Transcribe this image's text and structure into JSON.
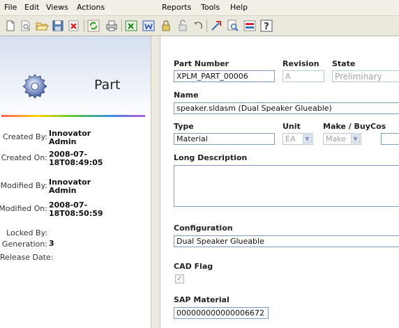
{
  "menubar": {
    "items": [
      "File",
      "Edit",
      "Views",
      "Actions",
      "Reports",
      "Tools",
      "Help"
    ]
  },
  "toolbar": {
    "icons": [
      "new-document-icon",
      "print-preview-icon",
      "open-folder-icon",
      "save-icon",
      "delete-icon",
      "refresh-icon",
      "print-icon",
      "excel-icon",
      "word-icon",
      "lock-icon",
      "unlock-icon",
      "undo-icon",
      "promote-icon",
      "search-icon",
      "report-icon",
      "help-icon"
    ]
  },
  "header": {
    "title": "Part"
  },
  "meta": {
    "created_by_label": "Created By:",
    "created_by": "Innovator Admin",
    "created_on_label": "Created On:",
    "created_on": "2008-07-18T08:49:05",
    "modified_by_label": "Modified By:",
    "modified_by": "Innovator Admin",
    "modified_on_label": "Modified On:",
    "modified_on": "2008-07-18T08:50:59",
    "locked_by_label": "Locked By:",
    "locked_by": "",
    "generation_label": "Generation:",
    "generation": "3",
    "release_date_label": "Release Date:",
    "release_date": ""
  },
  "form": {
    "part_number_label": "Part Number",
    "part_number": "XPLM_PART_00006",
    "revision_label": "Revision",
    "revision": "A",
    "state_label": "State",
    "state": "Preliminary",
    "name_label": "Name",
    "name": "speaker.sldasm (Dual Speaker Glueable)",
    "type_label": "Type",
    "type": "Material",
    "unit_label": "Unit",
    "unit": "EA",
    "make_buy_label": "Make / Buy",
    "make_buy": "Make",
    "cost_label": "Cos",
    "cost": "",
    "long_description_label": "Long Description",
    "long_description": "",
    "configuration_label": "Configuration",
    "configuration": "Dual Speaker Glueable",
    "cad_flag_label": "CAD Flag",
    "cad_flag_checked": true,
    "sap_material_label": "SAP Material",
    "sap_material": "000000000000006672"
  }
}
